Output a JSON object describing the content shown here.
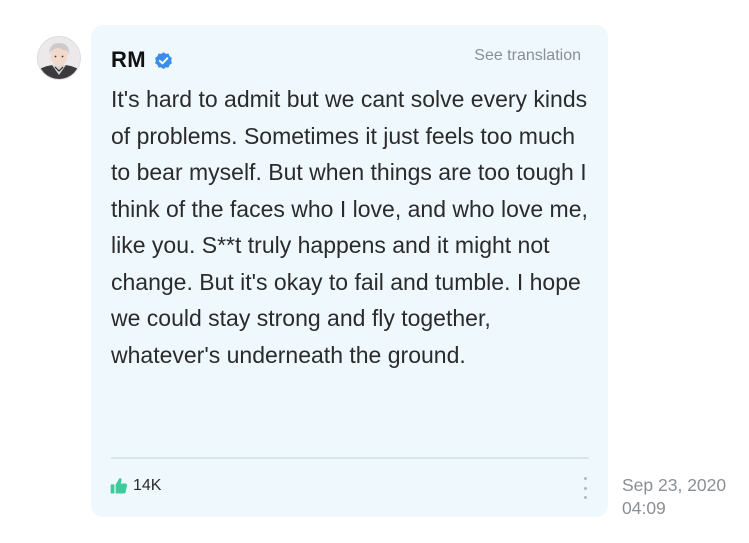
{
  "post": {
    "author": "RM",
    "see_translation": "See translation",
    "body": "It's hard to admit but we cant solve every kinds of problems. Sometimes it just feels too much to bear myself. But when things are too tough I think of the faces who I love, and who love me, like you. S**t truly happens and it might not change. But it's okay to fail and tumble. I hope we could stay strong and fly together, whatever's underneath the ground.",
    "likes": "14K",
    "date": "Sep 23, 2020",
    "time": "04:09"
  },
  "icons": {
    "verified": "verified-badge-icon",
    "like": "thumbs-up-icon",
    "more": "more-vertical-icon"
  },
  "colors": {
    "bubble_bg": "#eef8fd",
    "verified_blue": "#3b8ee8",
    "like_green": "#3ecb9a",
    "muted_text": "#8a8f96"
  }
}
